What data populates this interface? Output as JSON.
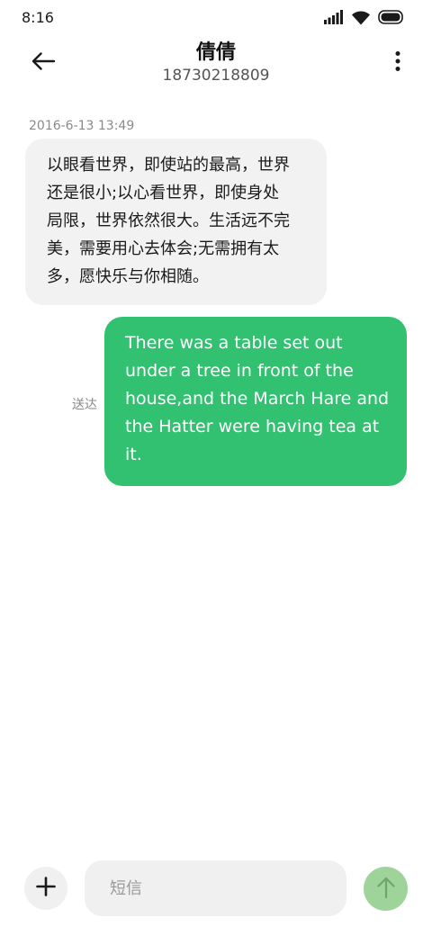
{
  "status_bar": {
    "time": "8:16",
    "icons": [
      "signal-icon",
      "wifi-icon",
      "battery-icon"
    ]
  },
  "header": {
    "contact_name": "倩倩",
    "contact_number": "18730218809",
    "back_icon": "arrow-left-icon",
    "more_icon": "more-vertical-icon"
  },
  "conversation": {
    "timestamp": "2016-6-13 13:49",
    "incoming_message": {
      "lines": [
        "以眼看世界，即使站的最高，世界",
        "还是很小;以心看世界，即使身处",
        "局限，世界依然很大。生活远不完",
        "美，需要用心去体会;无需拥有太",
        "多，愿快乐与你相随。"
      ]
    },
    "outgoing_message": {
      "lines": [
        "There was a table set out",
        "under a tree in front of the",
        "house,and the March Hare and",
        "the Hatter were having tea at",
        "it."
      ],
      "status": "送达"
    }
  },
  "composer": {
    "placeholder": "短信",
    "value": "",
    "add_icon": "plus-icon",
    "send_icon": "arrow-up-icon"
  },
  "colors": {
    "outgoing_bubble": "#31c170",
    "incoming_bubble": "#f2f2f2",
    "send_button": "#9ed39a",
    "input_background": "#f0f0f0"
  }
}
